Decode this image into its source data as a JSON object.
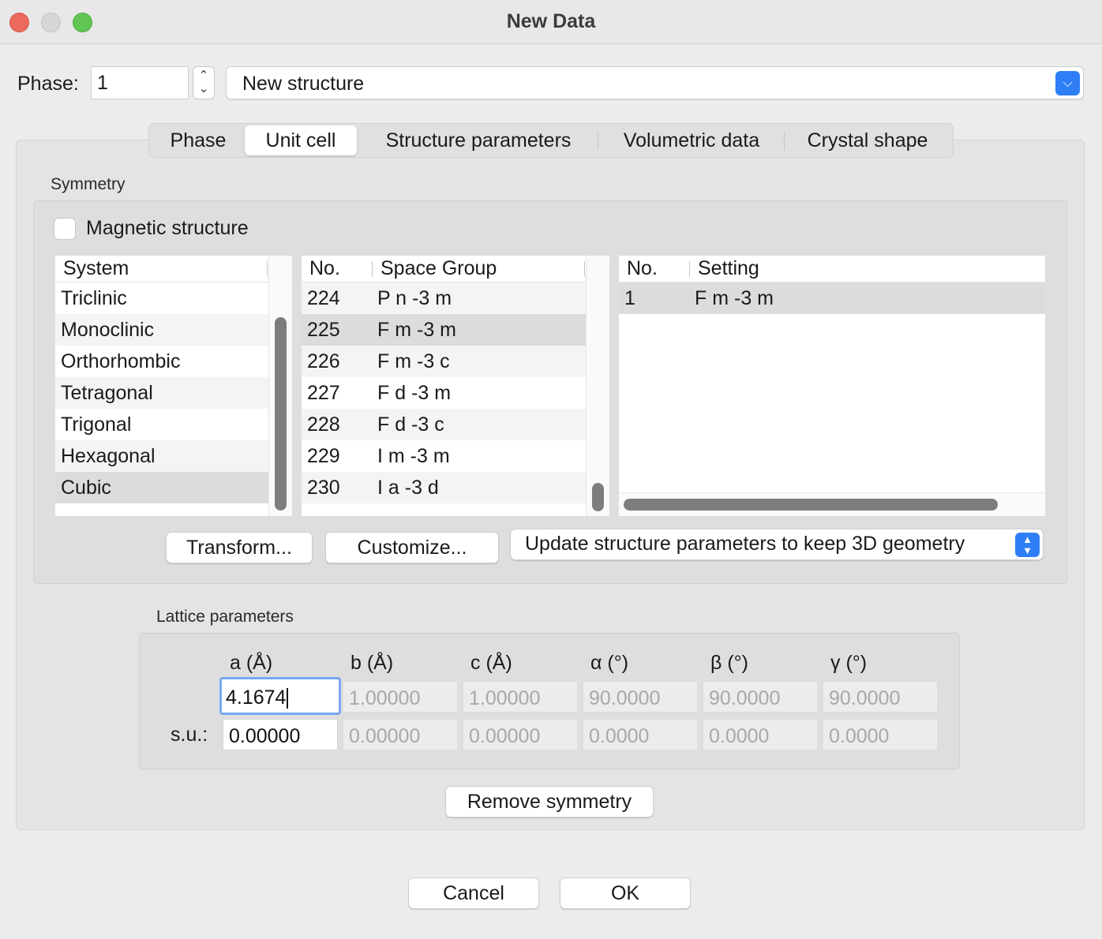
{
  "window": {
    "title": "New Data"
  },
  "phase": {
    "label": "Phase:",
    "value": "1",
    "structure_name": "New structure"
  },
  "tabs": [
    "Phase",
    "Unit cell",
    "Structure parameters",
    "Volumetric data",
    "Crystal shape"
  ],
  "active_tab": "Unit cell",
  "symmetry": {
    "section_label": "Symmetry",
    "magnetic_label": "Magnetic structure",
    "magnetic_checked": false,
    "system_list": {
      "header": "System",
      "items": [
        "Triclinic",
        "Monoclinic",
        "Orthorhombic",
        "Tetragonal",
        "Trigonal",
        "Hexagonal",
        "Cubic"
      ],
      "selected": "Cubic"
    },
    "space_group_list": {
      "headers": [
        "No.",
        "Space Group"
      ],
      "rows": [
        {
          "no": "224",
          "name": "P n -3 m"
        },
        {
          "no": "225",
          "name": "F m -3 m"
        },
        {
          "no": "226",
          "name": "F m -3 c"
        },
        {
          "no": "227",
          "name": "F d -3 m"
        },
        {
          "no": "228",
          "name": "F d -3 c"
        },
        {
          "no": "229",
          "name": "I m -3 m"
        },
        {
          "no": "230",
          "name": "I a -3 d"
        }
      ],
      "selected_no": "225"
    },
    "setting_list": {
      "headers": [
        "No.",
        "Setting"
      ],
      "rows": [
        {
          "no": "1",
          "name": "F m -3 m"
        }
      ]
    },
    "transform_label": "Transform...",
    "customize_label": "Customize...",
    "update_option": "Update structure parameters to keep 3D geometry"
  },
  "lattice": {
    "section_label": "Lattice parameters",
    "headers": [
      "a (Å)",
      "b (Å)",
      "c (Å)",
      "α (°)",
      "β (°)",
      "γ (°)"
    ],
    "values": [
      "4.1674",
      "1.00000",
      "1.00000",
      "90.0000",
      "90.0000",
      "90.0000"
    ],
    "su_label": "s.u.:",
    "su_values": [
      "0.00000",
      "0.00000",
      "0.00000",
      "0.0000",
      "0.0000",
      "0.0000"
    ],
    "remove_symmetry_label": "Remove symmetry"
  },
  "footer": {
    "cancel_label": "Cancel",
    "ok_label": "OK"
  }
}
